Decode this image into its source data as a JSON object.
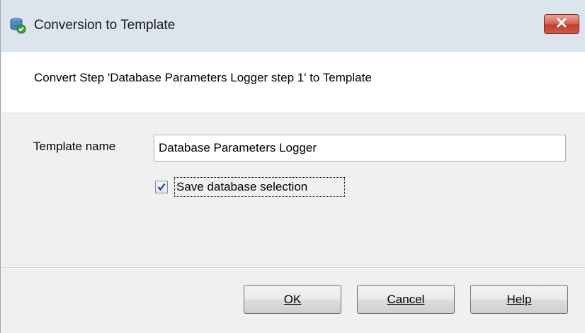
{
  "window": {
    "title": "Conversion to Template",
    "icon": "database-template-icon",
    "close_icon": "close-icon"
  },
  "header": {
    "text": "Convert Step 'Database Parameters Logger step 1' to Template"
  },
  "form": {
    "template_label": "Template name",
    "template_value": "Database Parameters Logger",
    "checkbox_label": "Save database selection",
    "checkbox_checked": true
  },
  "buttons": {
    "ok": "OK",
    "cancel": "Cancel",
    "help": "Help"
  },
  "colors": {
    "titlebar": "#dce4ee",
    "close_button": "#c9483a",
    "dialog_bg": "#f0f0f0"
  }
}
